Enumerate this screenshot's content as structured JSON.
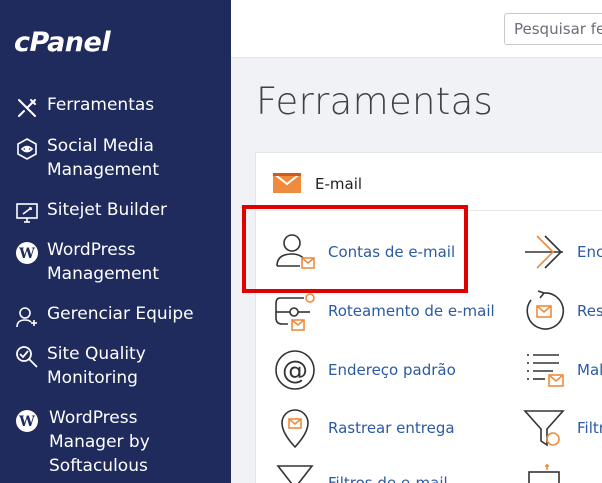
{
  "brand": {
    "logo": "cPanel"
  },
  "search": {
    "placeholder": "Pesquisar fe"
  },
  "page": {
    "title": "Ferramentas"
  },
  "sidebar": {
    "items": [
      {
        "label": "Ferramentas",
        "icon": "tools-icon"
      },
      {
        "label": "Social Media\nManagement",
        "icon": "social-media-icon"
      },
      {
        "label": "Sitejet Builder",
        "icon": "sitejet-icon"
      },
      {
        "label": "WordPress\nManagement",
        "icon": "wordpress-icon"
      },
      {
        "label": "Gerenciar Equipe",
        "icon": "team-icon"
      },
      {
        "label": "Site Quality\nMonitoring",
        "icon": "site-quality-icon"
      },
      {
        "label": "WordPress\nManager by\nSoftaculous",
        "icon": "wordpress-icon"
      }
    ]
  },
  "email_section": {
    "title": "E-mail",
    "tools_left": [
      {
        "label": "Contas de e-mail",
        "icon": "email-accounts-icon"
      },
      {
        "label": "Roteamento de e-mail",
        "icon": "email-routing-icon"
      },
      {
        "label": "Endereço padrão",
        "icon": "default-address-icon"
      },
      {
        "label": "Rastrear entrega",
        "icon": "track-delivery-icon"
      },
      {
        "label": "Filtros de e-mail",
        "icon": "email-filters-icon"
      }
    ],
    "tools_right": [
      {
        "label": "Enc",
        "icon": "forwarders-icon"
      },
      {
        "label": "Res",
        "icon": "autoresponders-icon"
      },
      {
        "label": "Mal",
        "icon": "mailing-lists-icon"
      },
      {
        "label": "Filtr",
        "icon": "global-filters-icon"
      },
      {
        "label": "",
        "icon": "encryption-icon"
      }
    ]
  },
  "colors": {
    "sidebar": "#1f2b5c",
    "accent_orange": "#f08a3c",
    "link": "#2c5aa0",
    "highlight": "#e00000"
  }
}
